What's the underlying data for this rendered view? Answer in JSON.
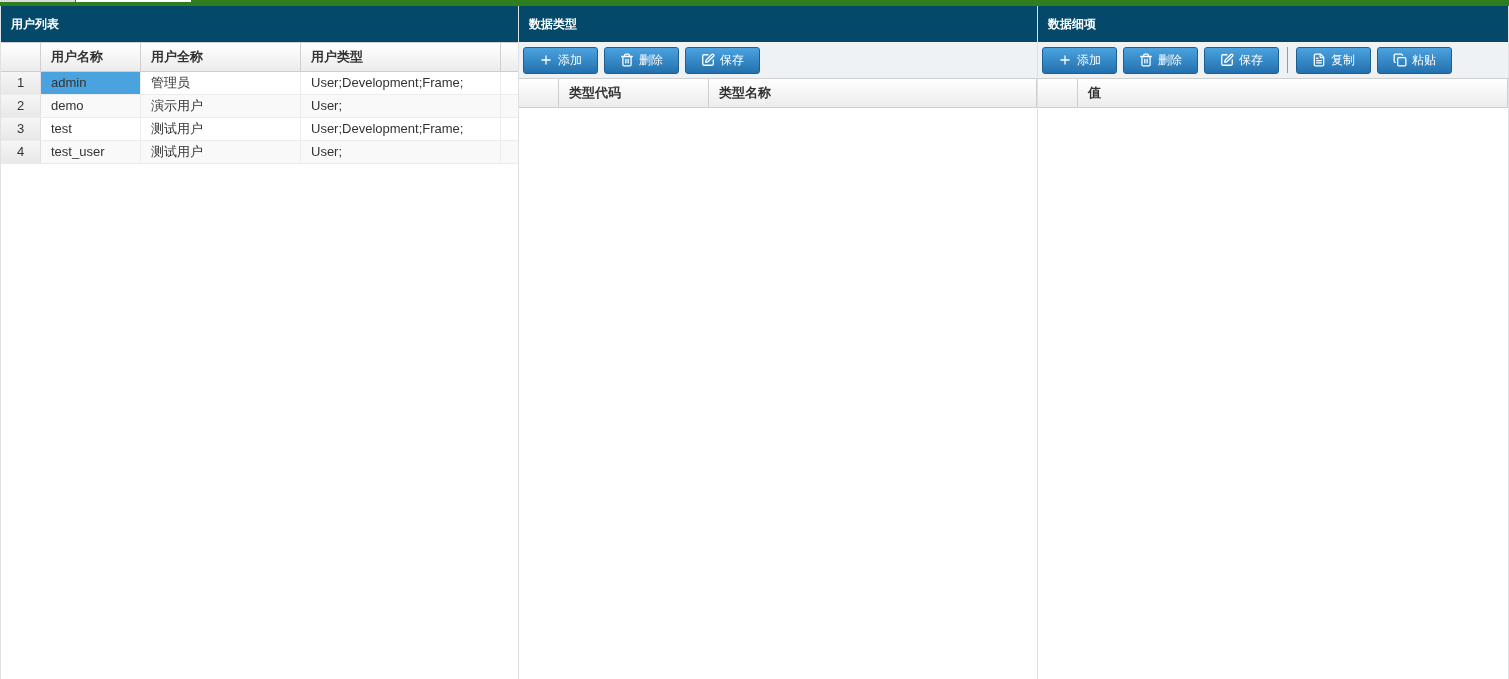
{
  "panels": [
    {
      "title": "用户列表",
      "columns": [
        "用户名称",
        "用户全称",
        "用户类型"
      ],
      "rows": [
        {
          "number": "1",
          "cells": [
            "admin",
            "管理员",
            "User;Development;Frame;"
          ],
          "selected": true
        },
        {
          "number": "2",
          "cells": [
            "demo",
            "演示用户",
            "User;"
          ],
          "selected": false
        },
        {
          "number": "3",
          "cells": [
            "test",
            "测试用户",
            "User;Development;Frame;"
          ],
          "selected": false
        },
        {
          "number": "4",
          "cells": [
            "test_user",
            "测试用户",
            "User;"
          ],
          "selected": false
        }
      ]
    },
    {
      "title": "数据类型",
      "toolbar": [
        {
          "kind": "add",
          "label": "添加"
        },
        {
          "kind": "delete",
          "label": "删除"
        },
        {
          "kind": "save",
          "label": "保存"
        }
      ],
      "columns": [
        "类型代码",
        "类型名称"
      ]
    },
    {
      "title": "数据细项",
      "toolbar": [
        {
          "kind": "add",
          "label": "添加"
        },
        {
          "kind": "delete",
          "label": "删除"
        },
        {
          "kind": "save",
          "label": "保存"
        },
        {
          "kind": "separator"
        },
        {
          "kind": "copy",
          "label": "复制"
        },
        {
          "kind": "paste",
          "label": "粘贴"
        }
      ],
      "columns": [
        "值"
      ]
    }
  ]
}
